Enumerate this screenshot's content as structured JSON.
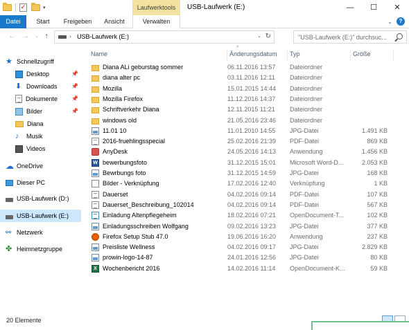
{
  "window": {
    "title": "USB-Laufwerk (E:)",
    "context_tab": "Laufwerktools",
    "min_glyph": "—",
    "max_glyph": "☐",
    "close_glyph": "✕"
  },
  "ribbon": {
    "tabs": [
      "Datei",
      "Start",
      "Freigeben",
      "Ansicht",
      "Verwalten"
    ]
  },
  "address": {
    "path": "USB-Laufwerk (E:)",
    "search_placeholder": "\"USB-Laufwerk (E:)\" durchsuc..."
  },
  "navigation": {
    "items": [
      {
        "label": "Schnellzugriff",
        "icon": "star-icon"
      },
      {
        "label": "Desktop",
        "icon": "desktop-icon",
        "pinned": true
      },
      {
        "label": "Downloads",
        "icon": "download-icon",
        "pinned": true
      },
      {
        "label": "Dokumente",
        "icon": "documents-icon",
        "pinned": true
      },
      {
        "label": "Bilder",
        "icon": "pictures-icon",
        "pinned": true
      },
      {
        "label": "Diana",
        "icon": "folder-icon"
      },
      {
        "label": "Musik",
        "icon": "music-icon"
      },
      {
        "label": "Videos",
        "icon": "videos-icon"
      },
      {
        "label": "OneDrive",
        "icon": "cloud-icon"
      },
      {
        "label": "Dieser PC",
        "icon": "computer-icon"
      },
      {
        "label": "USB-Laufwerk (D:)",
        "icon": "drive-icon"
      },
      {
        "label": "USB-Laufwerk (E:)",
        "icon": "drive-icon",
        "selected": true
      },
      {
        "label": "Netzwerk",
        "icon": "network-icon"
      },
      {
        "label": "Heimnetzgruppe",
        "icon": "homegroup-icon"
      }
    ]
  },
  "columns": {
    "name": "Name",
    "date": "Änderungsdatum",
    "type": "Typ",
    "size": "Größe"
  },
  "files": [
    {
      "name": "Diana ALi geburstag sommer",
      "date": "06.11.2016 13:57",
      "type": "Dateiordner",
      "size": "",
      "kind": "folder"
    },
    {
      "name": "diana alter pc",
      "date": "03.11.2016 12:11",
      "type": "Dateiordner",
      "size": "",
      "kind": "folder"
    },
    {
      "name": "Mozilla",
      "date": "15.01.2015 14:44",
      "type": "Dateiordner",
      "size": "",
      "kind": "folder"
    },
    {
      "name": "Mozilla Firefox",
      "date": "11.12.2016 14:37",
      "type": "Dateiordner",
      "size": "",
      "kind": "folder"
    },
    {
      "name": "Schriftverkehr Diana",
      "date": "12.11.2015 11:21",
      "type": "Dateiordner",
      "size": "",
      "kind": "folder"
    },
    {
      "name": "windows old",
      "date": "21.05.2016 23:46",
      "type": "Dateiordner",
      "size": "",
      "kind": "folder"
    },
    {
      "name": "11.01 10",
      "date": "11.01.2010 14:55",
      "type": "JPG-Datei",
      "size": "1.491 KB",
      "kind": "jpg"
    },
    {
      "name": "2016-fruehlingsspecial",
      "date": "25.02.2016 21:39",
      "type": "PDF-Datei",
      "size": "869 KB",
      "kind": "pdf"
    },
    {
      "name": "AnyDesk",
      "date": "24.05.2016 14:13",
      "type": "Anwendung",
      "size": "1.456 KB",
      "kind": "app"
    },
    {
      "name": "bewerbungsfoto",
      "date": "31.12.2015 15:01",
      "type": "Microsoft Word-D...",
      "size": "2.053 KB",
      "kind": "word"
    },
    {
      "name": "Bewrbungs foto",
      "date": "31.12.2015 14:59",
      "type": "JPG-Datei",
      "size": "168 KB",
      "kind": "jpg"
    },
    {
      "name": "Bilder - Verknüpfung",
      "date": "17.02.2016 12:40",
      "type": "Verknüpfung",
      "size": "1 KB",
      "kind": "lnk"
    },
    {
      "name": "Dauerset",
      "date": "04.02.2016 09:14",
      "type": "PDF-Datei",
      "size": "107 KB",
      "kind": "pdf"
    },
    {
      "name": "Dauerset_Beschreibung_102014",
      "date": "04.02.2016 09:14",
      "type": "PDF-Datei",
      "size": "567 KB",
      "kind": "pdf"
    },
    {
      "name": "Einladung Altenpflegeheim",
      "date": "18.02.2016 07:21",
      "type": "OpenDocument-T...",
      "size": "102 KB",
      "kind": "odt"
    },
    {
      "name": "Einladungsschreiben Wolfgang",
      "date": "09.02.2016 13:23",
      "type": "JPG-Datei",
      "size": "377 KB",
      "kind": "jpg"
    },
    {
      "name": "Firefox Setup Stub 47.0",
      "date": "19.06.2016 16:20",
      "type": "Anwendung",
      "size": "237 KB",
      "kind": "fox"
    },
    {
      "name": "Preisliste Wellness",
      "date": "04.02.2016 09:17",
      "type": "JPG-Datei",
      "size": "2.829 KB",
      "kind": "jpg"
    },
    {
      "name": "prowin-logo-14-87",
      "date": "24.01.2016 12:56",
      "type": "JPG-Datei",
      "size": "80 KB",
      "kind": "jpg"
    },
    {
      "name": "Wochenbericht 2016",
      "date": "14.02.2016 11:14",
      "type": "OpenDocument-K...",
      "size": "59 KB",
      "kind": "xls"
    }
  ],
  "status": {
    "count_text": "20 Elemente"
  },
  "colors": {
    "file_tab": "#1979ca",
    "context_tab": "#f2e1a0",
    "selection": "#cce8ff"
  }
}
